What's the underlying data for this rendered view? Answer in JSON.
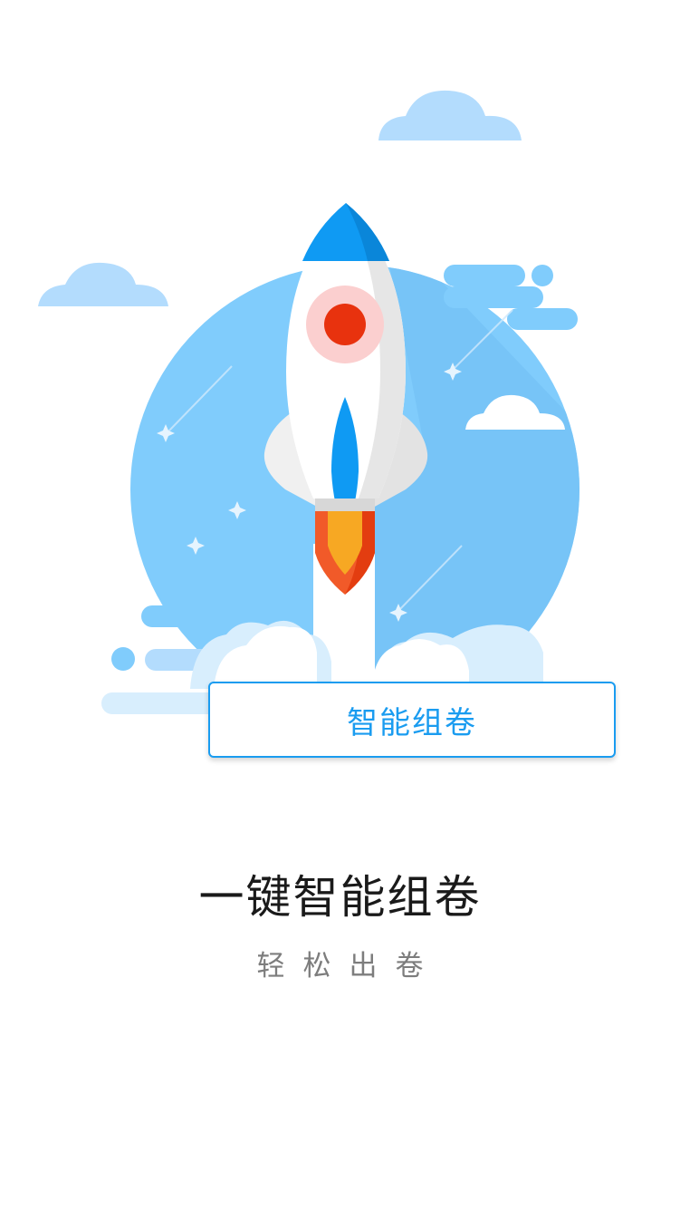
{
  "illustration": {
    "name": "rocket-launch",
    "colors": {
      "sky_circle": "#80ccfc",
      "cloud_light": "#b3dcfd",
      "cloud_pale": "#d8eefd",
      "rocket_nose": "#0f9af3",
      "rocket_body": "#ffffff",
      "window": "#e8320e",
      "flame_outer": "#f15a29",
      "flame_inner": "#f7a823"
    }
  },
  "main_button": {
    "label": "智能组卷"
  },
  "headline": "一键智能组卷",
  "subline": "轻松出卷"
}
